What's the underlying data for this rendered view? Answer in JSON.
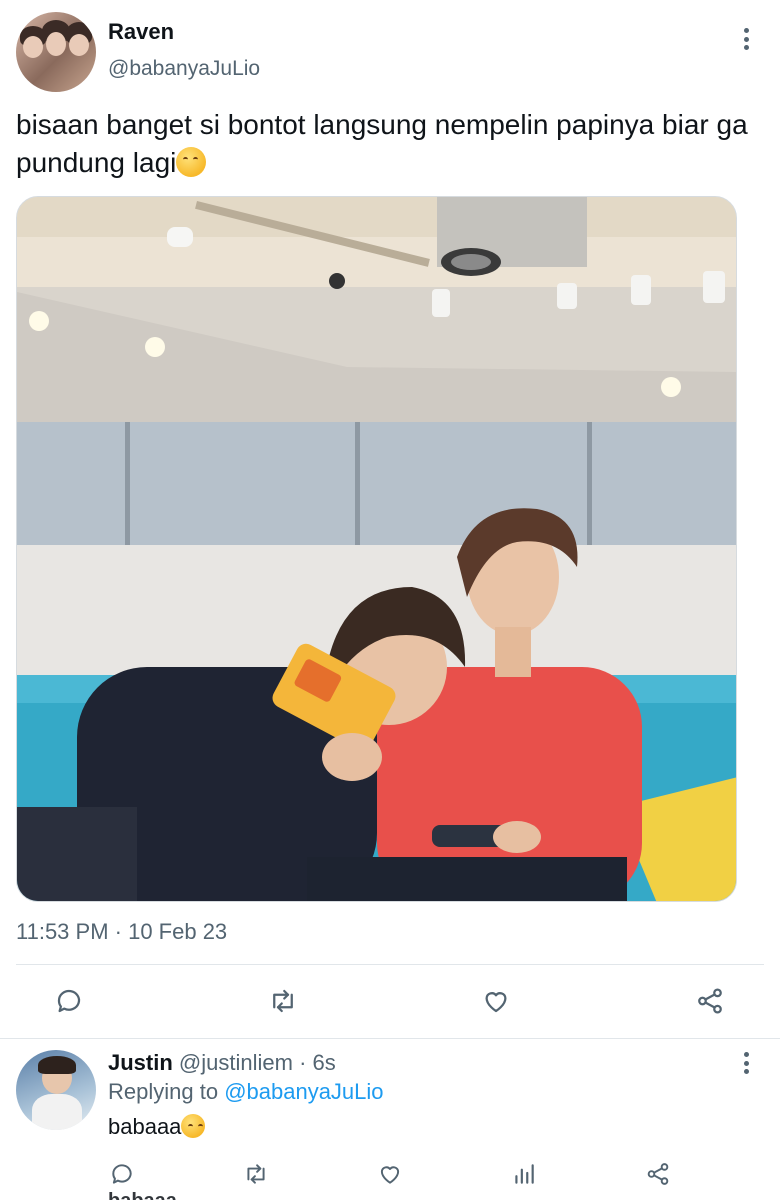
{
  "tweet": {
    "author": {
      "name": "Raven",
      "handle": "@babanyaJuLio",
      "avatar_icon": "profile-photo"
    },
    "text": "bisaan banget si bontot langsung nempelin papinya biar ga pundung lagi",
    "text_emoji": "face-with-hand-over-mouth",
    "timestamp": "11:53 PM · 10 Feb 23",
    "actions": [
      "reply-icon",
      "retweet-icon",
      "like-icon",
      "share-icon"
    ]
  },
  "reply": {
    "author": {
      "name": "Justin",
      "handle": "@justinliem",
      "age": "· 6s"
    },
    "replying_label": "Replying to ",
    "replying_to": "@babanyaJuLio",
    "text": "babaaa",
    "text_emoji": "weary-face",
    "actions": [
      "reply-icon",
      "retweet-icon",
      "like-icon",
      "views-icon",
      "share-icon"
    ]
  },
  "next_reply_peek": "babaaa",
  "colors": {
    "text_primary": "#0f1419",
    "text_secondary": "#536471",
    "link": "#1d9bf0",
    "divider": "#e1e6ea"
  }
}
